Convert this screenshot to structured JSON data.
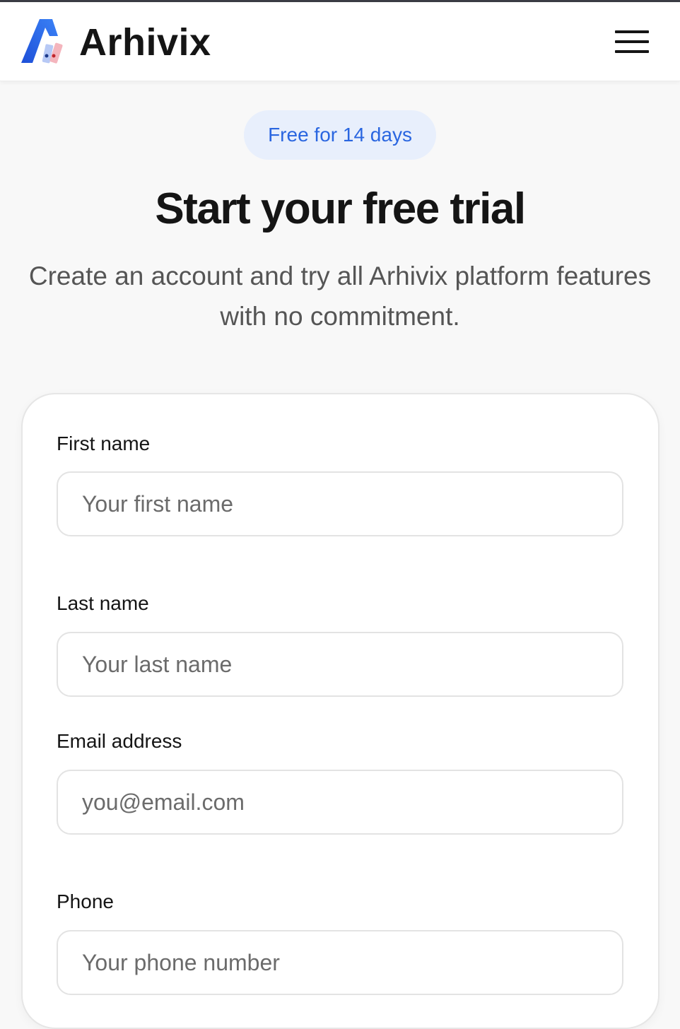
{
  "header": {
    "brand": "Arhivix",
    "logo_icon": "arhivix-logo-icon",
    "menu_icon": "hamburger-menu-icon"
  },
  "badge": {
    "label": "Free for 14 days"
  },
  "hero": {
    "title": "Start your free trial",
    "subtitle_line1": "Create an account and try all Arhivix platform features",
    "subtitle_line2": "with no commitment."
  },
  "form": {
    "first_name": {
      "label": "First name",
      "placeholder": "Your first name",
      "value": ""
    },
    "last_name": {
      "label": "Last name",
      "placeholder": "Your last name",
      "value": ""
    },
    "email": {
      "label": "Email address",
      "placeholder": "you@email.com",
      "value": ""
    },
    "phone": {
      "label": "Phone",
      "placeholder": "Your phone number",
      "value": ""
    }
  },
  "colors": {
    "accent": "#2a66e0",
    "badge_bg": "#e8effc",
    "text": "#151515",
    "muted": "#555555"
  }
}
